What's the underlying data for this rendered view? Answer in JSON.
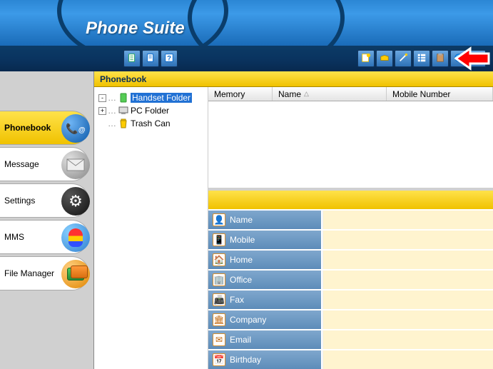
{
  "appTitle": "Phone Suite",
  "toolbar": {
    "leftButtons": [
      "new-doc-icon",
      "open-doc-icon",
      "help-icon"
    ],
    "rightButtons": [
      "new-contact-icon",
      "import-icon",
      "wand-icon",
      "grid-icon",
      "paste-icon",
      "globe-icon",
      "sort-icon"
    ]
  },
  "nav": [
    {
      "key": "phonebook",
      "label": "Phonebook",
      "icon": "phone-at-icon",
      "iconClass": "blue",
      "active": true
    },
    {
      "key": "message",
      "label": "Message",
      "icon": "envelope-icon",
      "iconClass": "grey",
      "active": false
    },
    {
      "key": "settings",
      "label": "Settings",
      "icon": "gears-icon",
      "iconClass": "dark",
      "active": false
    },
    {
      "key": "mms",
      "label": "MMS",
      "icon": "balloon-icon",
      "iconClass": "multi",
      "active": false
    },
    {
      "key": "filemanager",
      "label": "File Manager",
      "icon": "folder-stack-icon",
      "iconClass": "orange",
      "active": false
    }
  ],
  "contentTitle": "Phonebook",
  "tree": [
    {
      "label": "Handset Folder",
      "icon": "handset-icon",
      "toggle": "-",
      "selected": true
    },
    {
      "label": "PC Folder",
      "icon": "pc-icon",
      "toggle": "+",
      "selected": false
    },
    {
      "label": "Trash Can",
      "icon": "trash-icon",
      "toggle": "",
      "selected": false
    }
  ],
  "grid": {
    "columns": [
      {
        "label": "Memory",
        "sort": ""
      },
      {
        "label": "Name",
        "sort": "asc"
      },
      {
        "label": "Mobile Number",
        "sort": ""
      }
    ]
  },
  "detail": [
    {
      "label": "Name",
      "icon": "person-icon",
      "glyph": "👤"
    },
    {
      "label": "Mobile",
      "icon": "mobile-icon",
      "glyph": "📱"
    },
    {
      "label": "Home",
      "icon": "home-icon",
      "glyph": "🏠"
    },
    {
      "label": "Office",
      "icon": "office-icon",
      "glyph": "🏢"
    },
    {
      "label": "Fax",
      "icon": "fax-icon",
      "glyph": "📠"
    },
    {
      "label": "Company",
      "icon": "company-icon",
      "glyph": "🏛"
    },
    {
      "label": "Email",
      "icon": "email-icon",
      "glyph": "✉"
    },
    {
      "label": "Birthday",
      "icon": "birthday-icon",
      "glyph": "📅"
    }
  ]
}
